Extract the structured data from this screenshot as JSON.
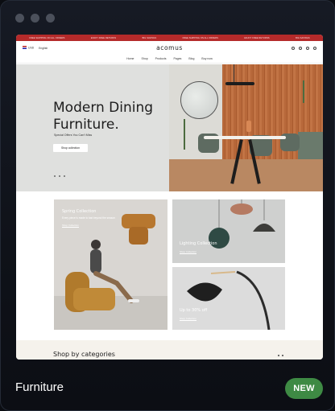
{
  "card": {
    "title": "Furniture",
    "badge": "NEW",
    "accent": "#3e8a44"
  },
  "site": {
    "logo": "acomus",
    "promo": [
      "FREE SHIPPING ON ALL ORDERS",
      "ENJOY FREE RETURNS",
      "BIG SAVINGS",
      "FREE SHIPPING ON ALL ORDERS",
      "ENJOY FREE RETURNS",
      "BIG SAVINGS"
    ],
    "currency": "USD",
    "language": "English",
    "nav": [
      "Home",
      "Shop",
      "Products",
      "Pages",
      "Blog",
      "Buy now"
    ],
    "hero": {
      "title_line1": "Modern Dining",
      "title_line2": "Furniture.",
      "subtitle": "Special Offers You Can't Miss",
      "button": "Shop collection"
    },
    "tiles": [
      {
        "caption": "Spring Collection",
        "desc": "Every piece is made to last beyond the season",
        "link": "Shop Collection"
      },
      {
        "caption": "Lighting Collection",
        "link": "Shop Collection"
      },
      {
        "caption": "Up to 30% off",
        "link": "Shop Collection"
      }
    ],
    "shop_by": "Shop by categories"
  }
}
